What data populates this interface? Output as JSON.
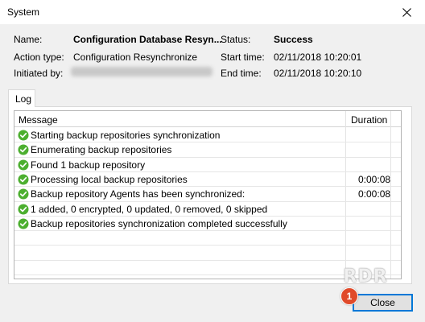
{
  "window": {
    "title": "System"
  },
  "info": {
    "name_label": "Name:",
    "name_value": "Configuration Database Resyn...",
    "action_type_label": "Action type:",
    "action_type_value": "Configuration Resynchronize",
    "initiated_by_label": "Initiated by:",
    "status_label": "Status:",
    "status_value": "Success",
    "start_time_label": "Start time:",
    "start_time_value": "02/11/2018 10:20:01",
    "end_time_label": "End time:",
    "end_time_value": "02/11/2018 10:20:10"
  },
  "log": {
    "tab_label": "Log",
    "columns": {
      "message": "Message",
      "duration": "Duration"
    },
    "rows": [
      {
        "message": "Starting backup repositories synchronization",
        "duration": ""
      },
      {
        "message": "Enumerating backup repositories",
        "duration": ""
      },
      {
        "message": "Found 1 backup repository",
        "duration": ""
      },
      {
        "message": "Processing local backup repositories",
        "duration": "0:00:08"
      },
      {
        "message": "Backup repository Agents has been synchronized:",
        "duration": "0:00:08"
      },
      {
        "message": "1 added, 0 encrypted, 0 updated, 0 removed, 0 skipped",
        "duration": ""
      },
      {
        "message": "Backup repositories synchronization completed successfully",
        "duration": ""
      }
    ]
  },
  "footer": {
    "close_label": "Close",
    "badge": "1",
    "watermark": "RDR"
  },
  "colors": {
    "success": "#4caf2f",
    "button_focus": "#0078d7",
    "badge": "#e04a2a"
  }
}
